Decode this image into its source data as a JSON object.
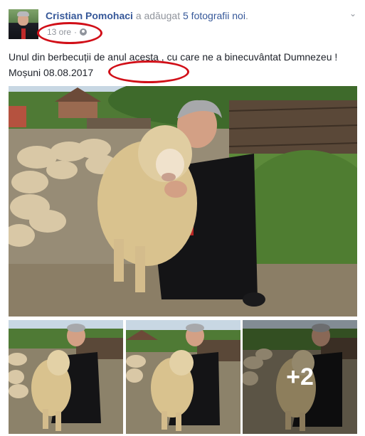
{
  "post": {
    "author_name": "Cristian Pomohaci",
    "action_prefix": "a adăugat",
    "action_link": "5 fotografii noi",
    "action_suffix": ".",
    "timestamp": "13 ore",
    "separator": "·",
    "audience_icon": "globe-icon",
    "menu_icon": "chevron-down-icon",
    "text_part1": "Unul din berbecuții de anul acesta , cu care ne a binecuvântat Dumnezeu ! Moșuni ",
    "text_date": "08.08.2017"
  },
  "gallery": {
    "main_photo": "photo-priest-with-ram",
    "thumbnails": [
      "photo-thumbnail-1",
      "photo-thumbnail-2",
      "photo-thumbnail-3"
    ],
    "more_label": "+2"
  },
  "colors": {
    "link": "#365899",
    "meta": "#90949c",
    "text": "#1d2129",
    "annotation": "#d10f18"
  }
}
